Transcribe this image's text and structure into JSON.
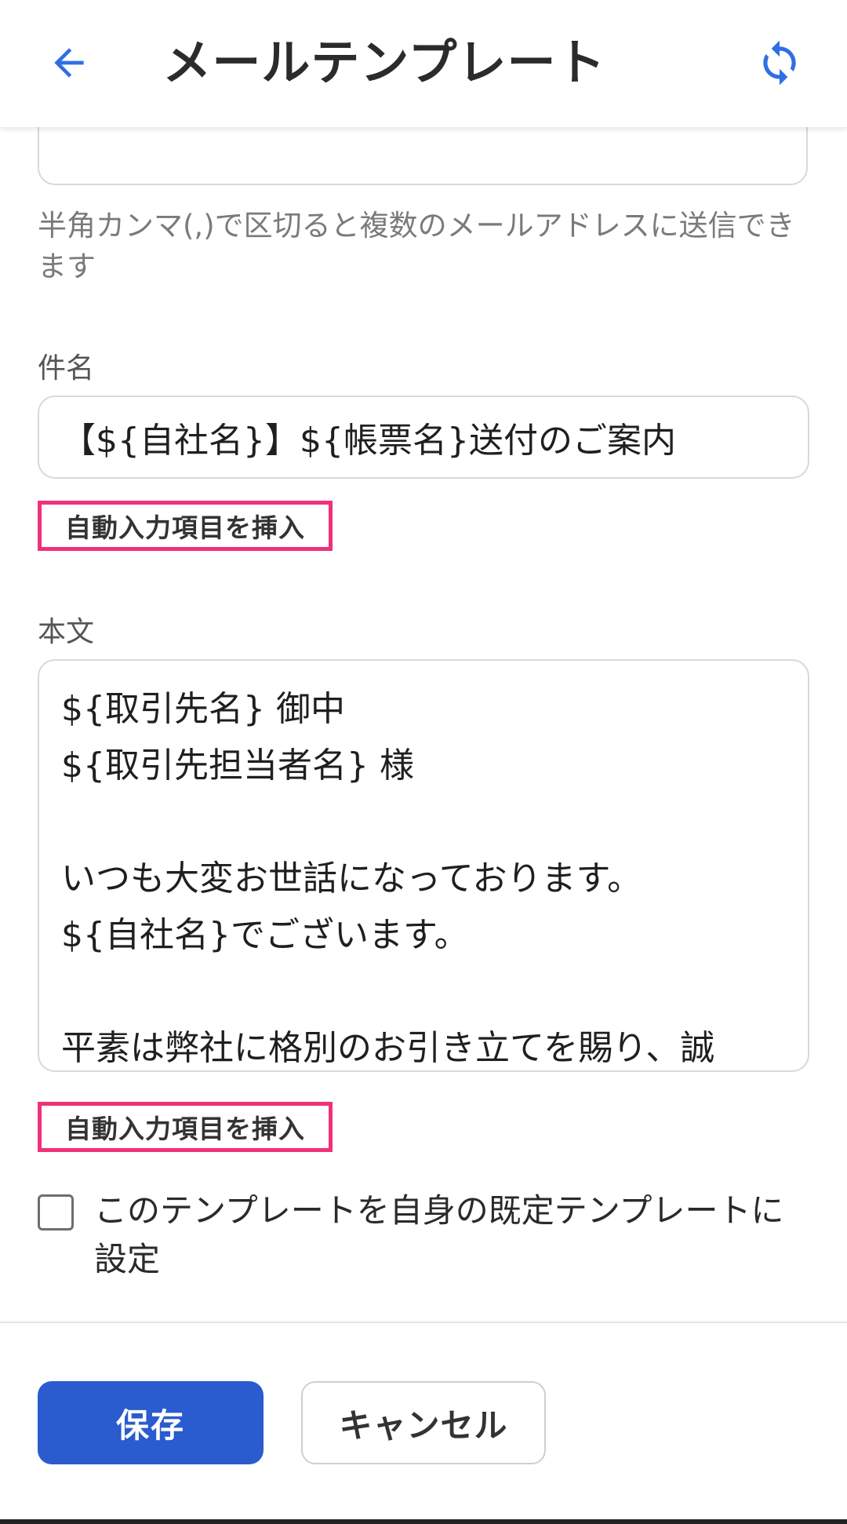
{
  "colors": {
    "accent": "#2a5bcf",
    "icon_blue": "#2f6fe4",
    "highlight": "#f0317a"
  },
  "header": {
    "title": "メールテンプレート",
    "back_icon": "arrow-left-icon",
    "refresh_icon": "refresh-icon"
  },
  "recipient": {
    "hint": "半角カンマ(,)で区切ると複数のメールアドレスに送信できます"
  },
  "subject": {
    "label": "件名",
    "value": "【${自社名}】${帳票名}送付のご案内",
    "insert_label": "自動入力項目を挿入"
  },
  "body": {
    "label": "本文",
    "lines": [
      "${取引先名} 御中",
      "${取引先担当者名} 様",
      "",
      "いつも大変お世話になっております。",
      "${自社名}でございます。",
      "",
      "平素は弊社に格別のお引き立てを賜り、誠"
    ],
    "insert_label": "自動入力項目を挿入"
  },
  "default_template": {
    "checked": false,
    "label": "このテンプレートを自身の既定テンプレートに設定"
  },
  "actions": {
    "save_label": "保存",
    "cancel_label": "キャンセル"
  }
}
